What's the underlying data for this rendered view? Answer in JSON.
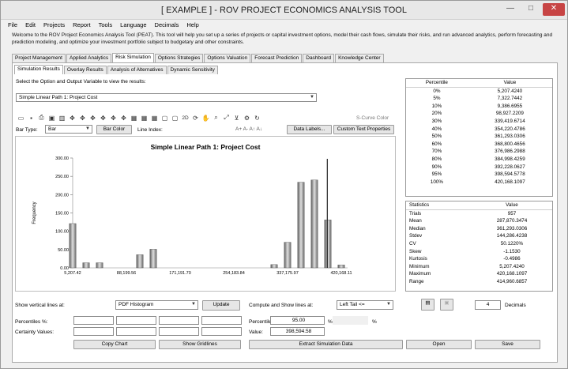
{
  "window": {
    "title": "[ EXAMPLE ] - ROV PROJECT ECONOMICS ANALYSIS TOOL",
    "min": "—",
    "max": "□",
    "close": "✕"
  },
  "menu": [
    "File",
    "Edit",
    "Projects",
    "Report",
    "Tools",
    "Language",
    "Decimals",
    "Help"
  ],
  "welcome": "Welcome to the ROV Project Economics Analysis Tool (PEAT). This tool will help you set up a series of projects or capital investment options, model their cash flows, simulate their risks, and run advanced analytics, perform forecasting and prediction modeling, and optimize your investment portfolio subject to budgetary and other constraints.",
  "main_tabs": [
    "Project Management",
    "Applied Analytics",
    "Risk Simulation",
    "Options Strategies",
    "Options Valuation",
    "Forecast Prediction",
    "Dashboard",
    "Knowledge Center"
  ],
  "sub_tabs": [
    "Simulation Results",
    "Overlay Results",
    "Analysis of Alternatives",
    "Dynamic Sensitivity"
  ],
  "select_prompt": "Select the Option and Output Variable to view the results:",
  "selected_variable": "Simple Linear Path 1: Project Cost",
  "toolbar": {
    "icons": [
      "folder-icon",
      "save-icon",
      "print-icon",
      "copy-icon",
      "chart-icon",
      "move-icon",
      "move-icon",
      "move-icon",
      "move-icon",
      "move-icon",
      "move-icon",
      "grid-icon",
      "grid-icon",
      "grid-icon",
      "frame-icon",
      "frame-icon",
      "label-2d",
      "rotate-icon",
      "hand-icon",
      "zoom-icon",
      "axis-icon",
      "filter-icon",
      "settings-icon",
      "refresh-icon"
    ],
    "label_2d": "2D",
    "scurve_color": "S-Curve Color",
    "bar_type_label": "Bar Type:",
    "bar_type_value": "Bar",
    "bar_color": "Bar Color",
    "line_index_label": "Line Index:",
    "font_tools": "A+  A-  A↑  A↓",
    "data_labels": "Data Labels...",
    "custom_text": "Custom Text Properties"
  },
  "chart_data": {
    "type": "bar",
    "title": "Simple Linear Path 1: Project Cost",
    "ylabel": "Frequency",
    "xlabel": "",
    "ylim": [
      0,
      300
    ],
    "y_ticks": [
      "300.00",
      "250.00",
      "200.00",
      "150.00",
      "100.00",
      "50.00",
      "0.00"
    ],
    "x_ticks": [
      "5,207.42",
      "88,199.56",
      "171,191.70",
      "254,183.84",
      "337,175.97",
      "420,168.11"
    ],
    "x_min": 5207.42,
    "x_max": 420168.11,
    "bin_width": 10374,
    "values": [
      121,
      14,
      14,
      0,
      0,
      0,
      36,
      51,
      0,
      0,
      0,
      0,
      0,
      0,
      0,
      0,
      0,
      0,
      0,
      0,
      0,
      0,
      0,
      0,
      0,
      0,
      0,
      0,
      0,
      0,
      0,
      0,
      0,
      0,
      0,
      0,
      0,
      0,
      0,
      0,
      0,
      0,
      0,
      0,
      0,
      0,
      0,
      0,
      0,
      0,
      0,
      0,
      0,
      0,
      0,
      0,
      0,
      0,
      0,
      0,
      0,
      0,
      0,
      0,
      0,
      0,
      0,
      0,
      0,
      0,
      9,
      70,
      234,
      240,
      131,
      8
    ],
    "bars": [
      {
        "x": 5207,
        "y": 121
      },
      {
        "x": 25955,
        "y": 14
      },
      {
        "x": 46703,
        "y": 14
      },
      {
        "x": 108947,
        "y": 36
      },
      {
        "x": 129695,
        "y": 51
      },
      {
        "x": 316427,
        "y": 9
      },
      {
        "x": 337175,
        "y": 70
      },
      {
        "x": 357923,
        "y": 234
      },
      {
        "x": 378671,
        "y": 240
      },
      {
        "x": 399419,
        "y": 131
      },
      {
        "x": 420168,
        "y": 8
      }
    ],
    "vertical_line_x": 398594.58
  },
  "percentiles": {
    "headers": [
      "Percentile",
      "Value"
    ],
    "rows": [
      [
        "0%",
        "5,207.4240"
      ],
      [
        "5%",
        "7,322.7442"
      ],
      [
        "10%",
        "9,386.6955"
      ],
      [
        "20%",
        "98,927.2209"
      ],
      [
        "30%",
        "339,419.6714"
      ],
      [
        "40%",
        "354,220.4786"
      ],
      [
        "50%",
        "361,293.0306"
      ],
      [
        "60%",
        "368,800.4656"
      ],
      [
        "70%",
        "376,986.2988"
      ],
      [
        "80%",
        "384,998.4259"
      ],
      [
        "90%",
        "392,228.0627"
      ],
      [
        "95%",
        "398,594.5778"
      ],
      [
        "100%",
        "420,168.1097"
      ]
    ]
  },
  "statistics": {
    "headers": [
      "Statistics",
      "Value"
    ],
    "rows": [
      [
        "Trials",
        "957"
      ],
      [
        "Mean",
        "287,870.3474"
      ],
      [
        "Median",
        "361,293.0306"
      ],
      [
        "Stdev",
        "144,286.4238"
      ],
      [
        "CV",
        "50.1220%"
      ],
      [
        "Skew",
        "-1.1530"
      ],
      [
        "Kurtosis",
        "-0.4986"
      ],
      [
        "Minimum",
        "5,207.4240"
      ],
      [
        "Maximum",
        "420,168.1097"
      ],
      [
        "Range",
        "414,960.6857"
      ]
    ]
  },
  "bottom": {
    "show_lines_label": "Show vertical lines at:",
    "show_lines_value": "PDF Histogram",
    "update": "Update",
    "compute_label": "Compute and Show lines at:",
    "compute_value": "Left Tail <=",
    "decimals_value": "4",
    "decimals_label": "Decimals",
    "percentiles_label": "Percentiles %:",
    "certainty_label": "Certainty Values:",
    "percentile_in_label": "Percentiles:",
    "percentile_in_value": "95.00",
    "pct_sign1": "%",
    "pct_sign2": "%",
    "value_label": "Value:",
    "value_value": "398,594.58",
    "copy_chart": "Copy Chart",
    "show_gridlines": "Show Gridlines",
    "extract": "Extract Simulation Data",
    "open": "Open",
    "save": "Save"
  }
}
